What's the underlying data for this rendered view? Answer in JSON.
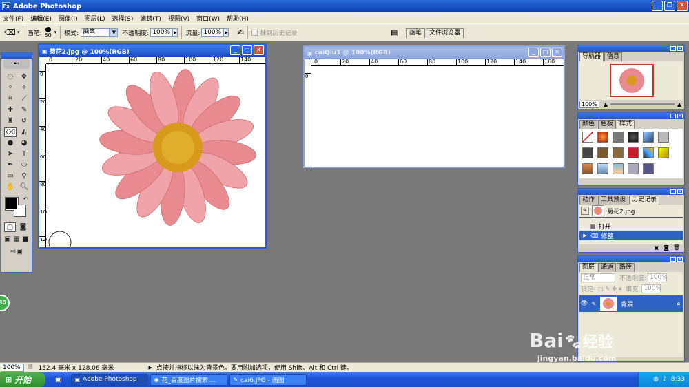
{
  "app": {
    "title": "Adobe Photoshop"
  },
  "menu": [
    "文件(F)",
    "编辑(E)",
    "图像(I)",
    "图层(L)",
    "选择(S)",
    "滤镜(T)",
    "视图(V)",
    "窗口(W)",
    "帮助(H)"
  ],
  "options": {
    "brush_label": "画笔:",
    "brush_size": "50",
    "mode_label": "模式:",
    "mode_value": "画笔",
    "opacity_label": "不透明度:",
    "opacity_value": "100%",
    "flow_label": "流量:",
    "flow_value": "100%",
    "erase_to_history": "抹到历史记录"
  },
  "palette_well": [
    "画笔",
    "文件浏览器"
  ],
  "documents": [
    {
      "title": "菊花2.jpg @ 100%(RGB)",
      "ruler": [
        "0",
        "20",
        "40",
        "60",
        "80",
        "100",
        "120",
        "140"
      ]
    },
    {
      "title": "caiQiu1 @ 100%(RGB)",
      "ruler": [
        "0",
        "20",
        "40",
        "60",
        "80",
        "100",
        "120",
        "140",
        "160"
      ]
    }
  ],
  "navigator": {
    "tabs": [
      "导航器",
      "信息"
    ],
    "zoom": "100%"
  },
  "color_panel": {
    "tabs": [
      "颜色",
      "色板",
      "样式"
    ]
  },
  "history_panel": {
    "tabs": [
      "动作",
      "工具预设",
      "历史记录"
    ],
    "snapshot": "菊花2.jpg",
    "items": [
      "打开",
      "修整"
    ]
  },
  "layers_panel": {
    "tabs": [
      "图层",
      "通道",
      "路径"
    ],
    "blend": "正常",
    "opacity_label": "不透明度:",
    "opacity": "100%",
    "lock_label": "锁定:",
    "fill_label": "填充:",
    "fill": "100%",
    "layer_name": "背景"
  },
  "status": {
    "zoom": "100%",
    "doc_size": "152.4 毫米 x 128.06 毫米",
    "hint": "点按并拖移以抹为背景色。要用附加选项，使用 Shift、Alt 和 Ctrl 键。"
  },
  "taskbar": {
    "start": "开始",
    "items": [
      "Adobe Photoshop",
      "花_百度图片搜索 ...",
      "cai6.JPG - 画图"
    ],
    "time": "8:33"
  },
  "badge": "30",
  "watermark": {
    "brand": "Bai",
    "brand2": "经验",
    "url": "jingyan.baidu.com"
  },
  "colors": {
    "title_blue": "#0a3fb0",
    "panel_bg": "#ece9d8",
    "workspace": "#797979",
    "petal": "#e88a8f",
    "center": "#d89a1d"
  }
}
